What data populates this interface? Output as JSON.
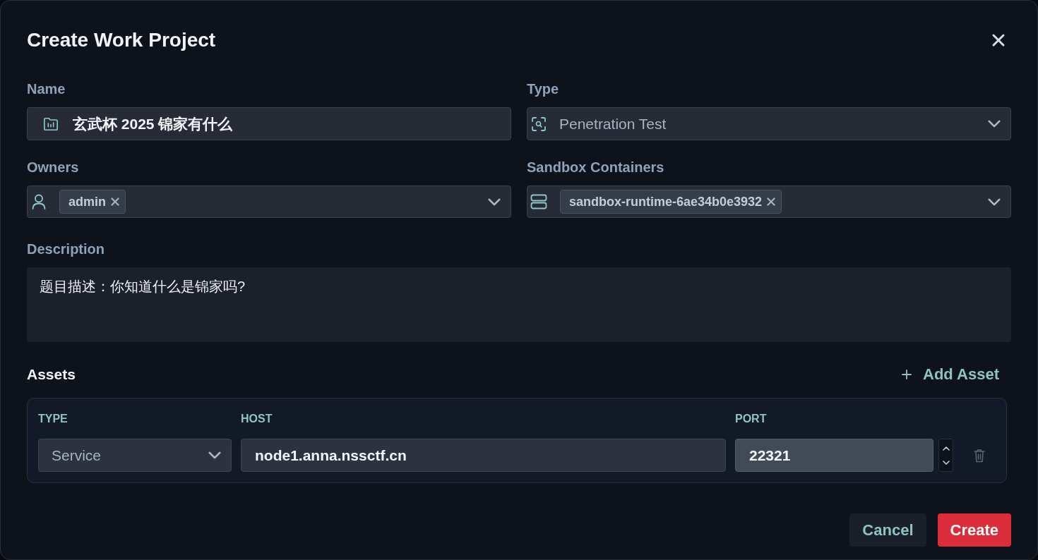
{
  "title": "Create Work Project",
  "name": {
    "label": "Name",
    "value": "玄武杯 2025 锦家有什么"
  },
  "type": {
    "label": "Type",
    "value": "Penetration Test"
  },
  "owners": {
    "label": "Owners",
    "tags": [
      "admin"
    ]
  },
  "sandbox_containers": {
    "label": "Sandbox Containers",
    "tags": [
      "sandbox-runtime-6ae34b0e3932"
    ]
  },
  "description": {
    "label": "Description",
    "value": "题目描述：你知道什么是锦家吗?"
  },
  "assets": {
    "title": "Assets",
    "add_label": "Add Asset",
    "columns": [
      "TYPE",
      "HOST",
      "PORT"
    ],
    "rows": [
      {
        "type": "Service",
        "host": "node1.anna.nssctf.cn",
        "port": "22321",
        "port_focused": true
      }
    ]
  },
  "buttons": [
    {
      "label": "Cancel",
      "kind": "secondary"
    },
    {
      "label": "Create",
      "kind": "primary"
    }
  ]
}
